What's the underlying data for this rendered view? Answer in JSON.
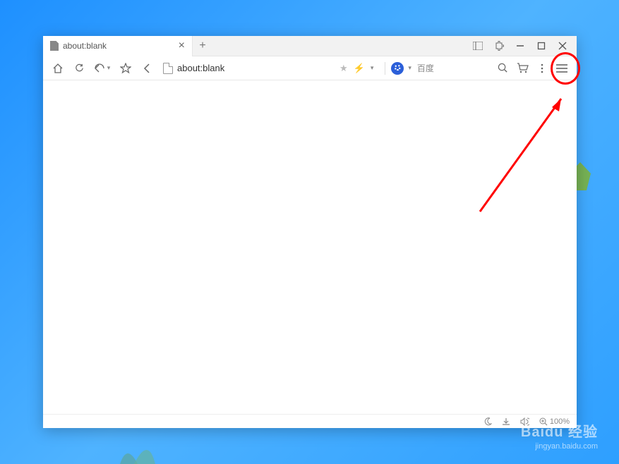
{
  "tab": {
    "title": "about:blank"
  },
  "toolbar": {
    "address": "about:blank",
    "search_engine": "百度"
  },
  "status": {
    "zoom": "100%"
  },
  "watermark": {
    "brand": "Baidu 经验",
    "url": "jingyan.baidu.com"
  }
}
